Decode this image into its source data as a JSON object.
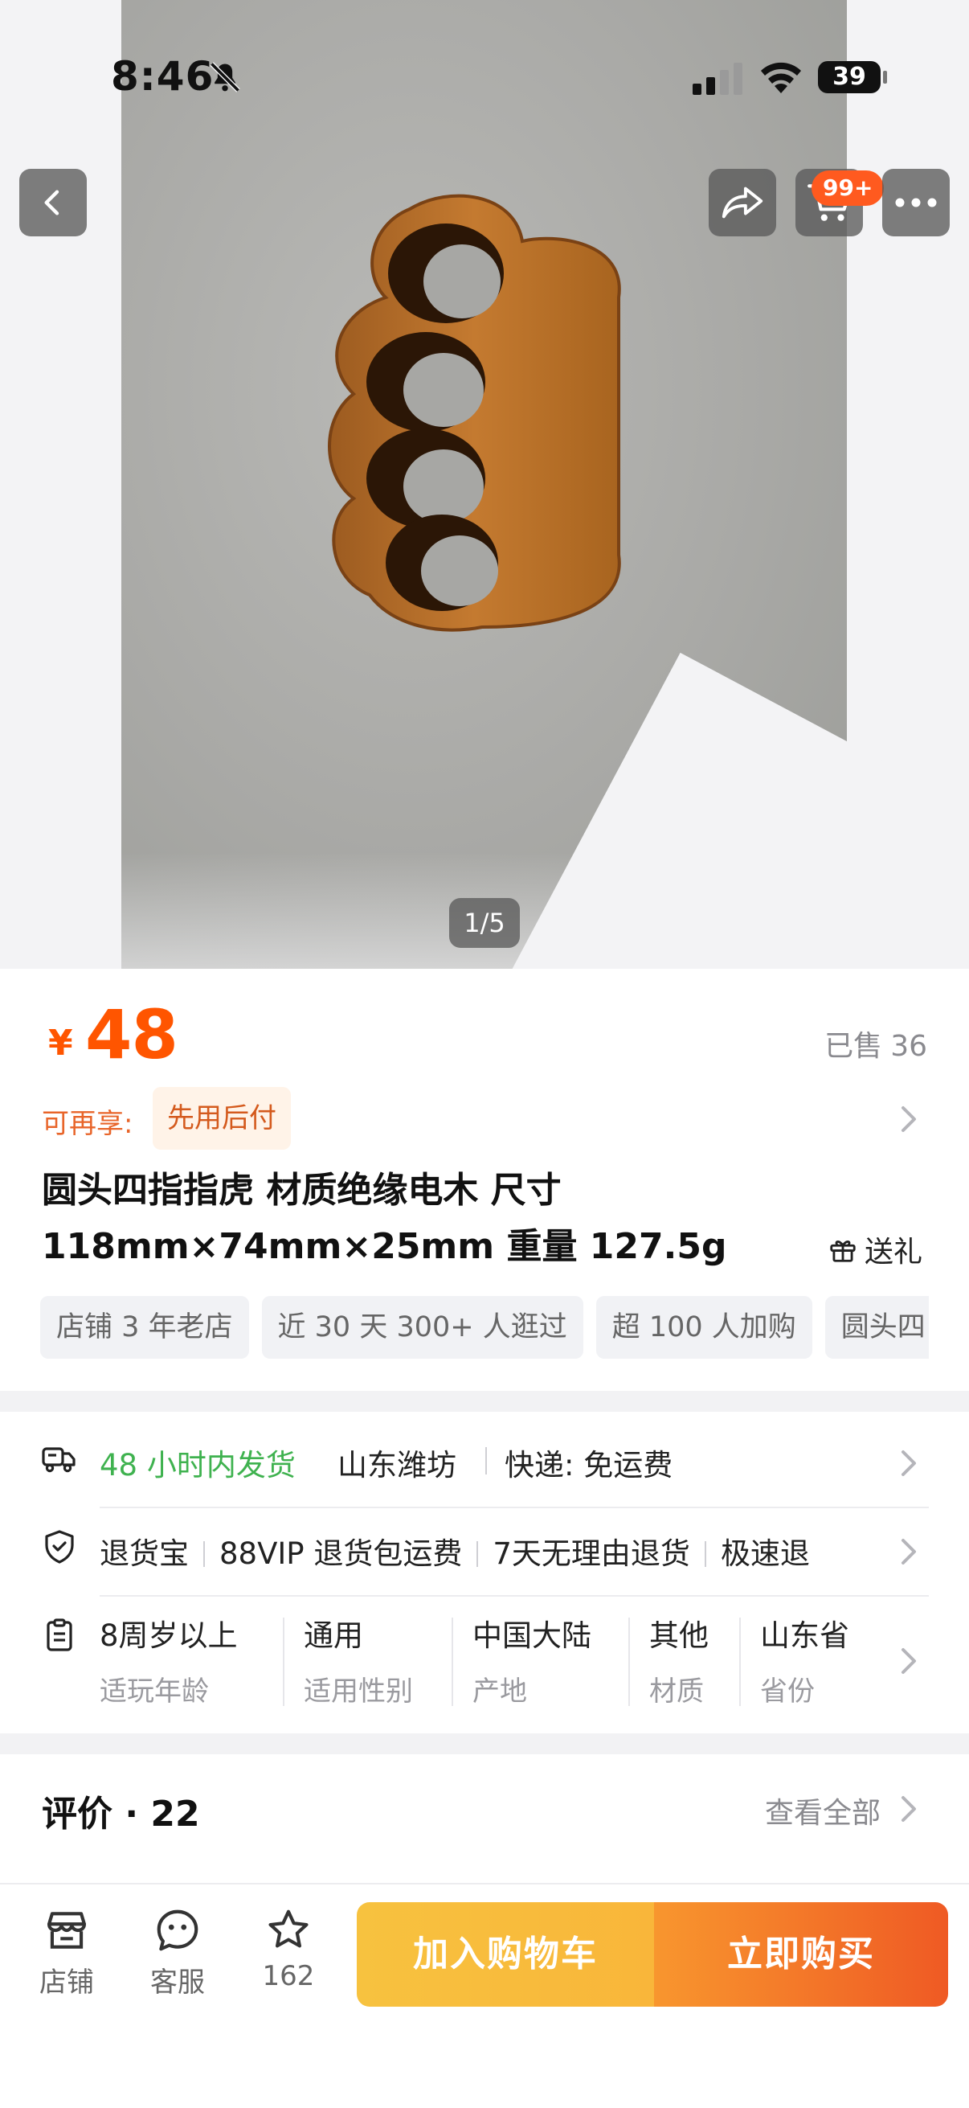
{
  "status_bar": {
    "time": "8:46",
    "battery": "39"
  },
  "nav": {
    "cart_badge": "99+"
  },
  "gallery": {
    "page_indicator": "1/5"
  },
  "price": {
    "currency": "¥",
    "amount": "48",
    "sold_label": "已售",
    "sold_count": "36"
  },
  "promo": {
    "label": "可再享:",
    "tag": "先用后付"
  },
  "product": {
    "title_line1": "圆头四指指虎 材质绝缘电木 尺寸",
    "title_line2": "118mm×74mm×25mm 重量 127.5g",
    "gift_label": "送礼"
  },
  "tags": [
    "店铺 3 年老店",
    "近 30 天 300+ 人逛过",
    "超 100 人加购",
    "圆头四"
  ],
  "shipping": {
    "time": "48 小时内发货",
    "origin": "山东潍坊",
    "delivery": "快递:  免运费"
  },
  "guarantees": [
    "退货宝",
    "88VIP 退货包运费",
    "7天无理由退货",
    "极速退"
  ],
  "attributes": [
    {
      "value": "8周岁以上",
      "key": "适玩年龄"
    },
    {
      "value": "通用",
      "key": "适用性别"
    },
    {
      "value": "中国大陆",
      "key": "产地"
    },
    {
      "value": "其他",
      "key": "材质"
    },
    {
      "value": "山东省",
      "key": "省份"
    }
  ],
  "reviews": {
    "title": "评价 · 22",
    "view_all": "查看全部"
  },
  "bottom_bar": {
    "store": "店铺",
    "service": "客服",
    "favorites": "162",
    "add_to_cart": "加入购物车",
    "buy_now": "立即购买"
  },
  "colors": {
    "accent": "#ff5500",
    "green": "#3fb24f",
    "cart_button": "#f7c23f",
    "buy_button": "#ef5a24"
  }
}
